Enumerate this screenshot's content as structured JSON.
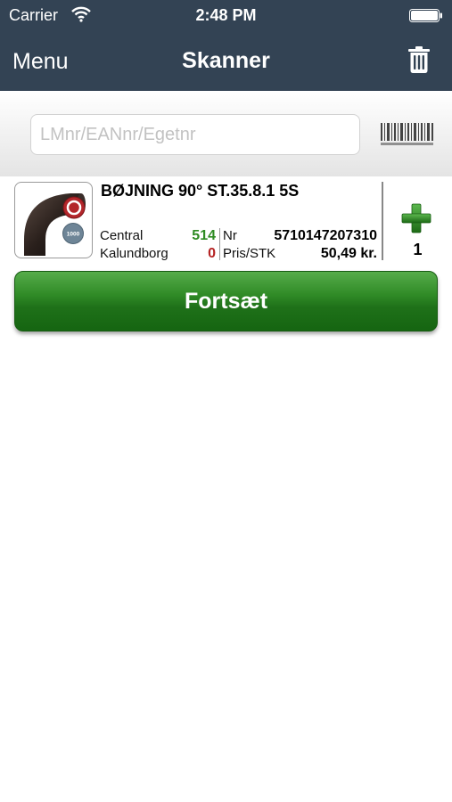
{
  "status_bar": {
    "carrier": "Carrier",
    "time": "2:48 PM"
  },
  "nav": {
    "menu_label": "Menu",
    "title": "Skanner",
    "trash_icon": "trash-icon"
  },
  "search": {
    "placeholder": "LMnr/EANnr/Egetnr",
    "value": "",
    "barcode_icon": "barcode-icon"
  },
  "product": {
    "title": "BØJNING 90° ST.35.8.1 5S",
    "stock": [
      {
        "label": "Central",
        "value": "514",
        "color": "#2e8b22"
      },
      {
        "label": "Kalundborg",
        "value": "0",
        "color": "#b52323"
      }
    ],
    "info": [
      {
        "label": "Nr",
        "value": "5710147207310"
      },
      {
        "label": "Pris/STK",
        "value": "50,49 kr."
      }
    ],
    "quantity": "1",
    "badge_blue_text": "1000"
  },
  "actions": {
    "continue_label": "Fortsæt"
  },
  "colors": {
    "nav_background": "#334354",
    "button_green": "#2f8a26"
  }
}
